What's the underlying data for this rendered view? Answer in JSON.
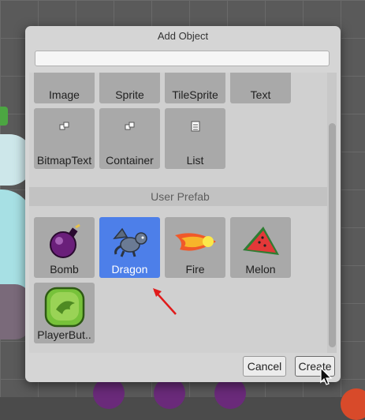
{
  "dialog": {
    "title": "Add Object",
    "search": {
      "value": "",
      "placeholder": ""
    }
  },
  "builtin_items": [
    {
      "label": "Image",
      "icon": "image-icon"
    },
    {
      "label": "Sprite",
      "icon": "sprite-icon"
    },
    {
      "label": "TileSprite",
      "icon": "tilesprite-icon"
    },
    {
      "label": "Text",
      "icon": "text-icon"
    },
    {
      "label": "BitmapText",
      "icon": "cubes-icon"
    },
    {
      "label": "Container",
      "icon": "cubes-icon"
    },
    {
      "label": "List",
      "icon": "list-icon"
    }
  ],
  "user_prefab": {
    "header": "User Prefab",
    "items": [
      {
        "label": "Bomb",
        "icon": "bomb-icon",
        "selected": false
      },
      {
        "label": "Dragon",
        "icon": "dragon-icon",
        "selected": true
      },
      {
        "label": "Fire",
        "icon": "fire-icon",
        "selected": false
      },
      {
        "label": "Melon",
        "icon": "melon-icon",
        "selected": false
      },
      {
        "label": "PlayerBut..",
        "icon": "player-button-icon",
        "selected": false
      }
    ]
  },
  "buttons": {
    "cancel": "Cancel",
    "create": "Create"
  },
  "colors": {
    "selected": "#4d7fe9",
    "tile": "#a9a9a9",
    "dialog": "#d5d5d5"
  }
}
